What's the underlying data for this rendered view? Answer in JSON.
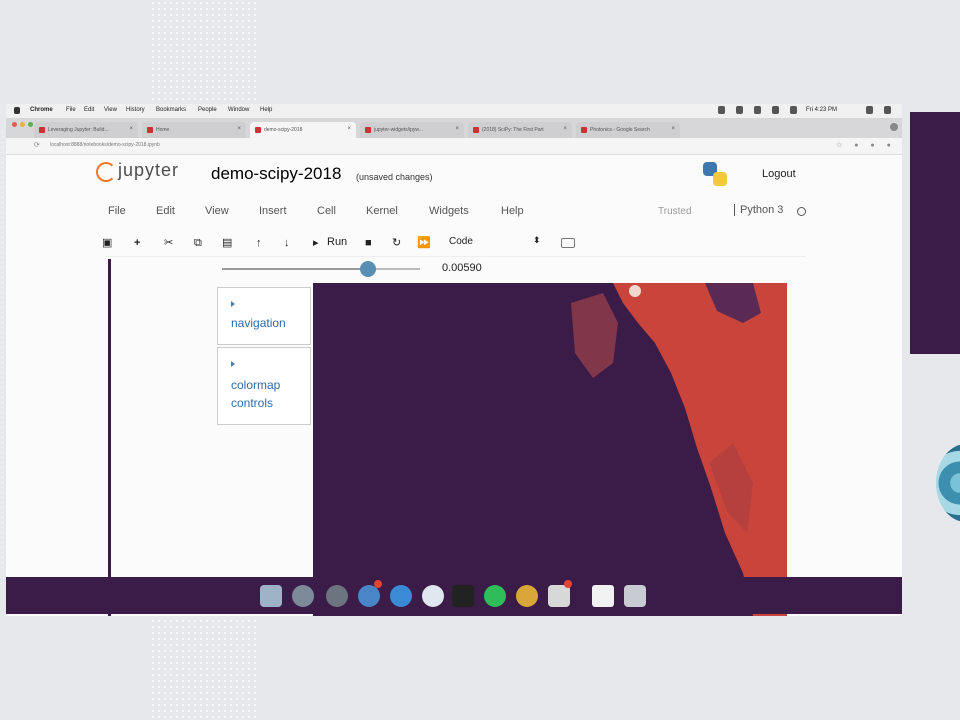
{
  "macos_menubar": {
    "app_name": "Chrome",
    "items": [
      "File",
      "Edit",
      "View",
      "History",
      "Bookmarks",
      "People",
      "Window",
      "Help"
    ],
    "clock": "Fri 4:23 PM"
  },
  "browser": {
    "tabs": [
      {
        "title": "Leveraging Jupyter: Build..."
      },
      {
        "title": "Home"
      },
      {
        "title": "demo-scipy-2018",
        "active": true
      },
      {
        "title": "jupyter-widgets/ipyw..."
      },
      {
        "title": "(2018) SciPy: The First Part"
      },
      {
        "title": "Photonics - Google Search"
      }
    ],
    "url": "localhost:8888/notebooks/demo-scipy-2018.ipynb"
  },
  "header": {
    "logo_text": "jupyter",
    "notebook_name": "demo-scipy-2018",
    "save_status": "(unsaved changes)",
    "logout_label": "Logout"
  },
  "menu": {
    "items": [
      "File",
      "Edit",
      "View",
      "Insert",
      "Cell",
      "Kernel",
      "Widgets",
      "Help"
    ],
    "trusted_label": "Trusted",
    "kernel_name": "Python 3"
  },
  "toolbar": {
    "run_label": "Run",
    "cell_type": "Code"
  },
  "widget": {
    "slider_value": "0.00590",
    "slider_fraction": 0.74,
    "accordions": [
      {
        "label": "navigation"
      },
      {
        "label": "colormap controls"
      }
    ]
  },
  "plot": {
    "colors": {
      "background": "#3b1c48",
      "highlight": "#c9443a"
    }
  },
  "dock": {
    "apps": [
      "Finder",
      "Launchpad",
      "System Preferences",
      "App Store",
      "Safari",
      "Preview",
      "Terminal",
      "Spotify",
      "Chrome",
      "Slack",
      "Script Editor",
      "Trash"
    ]
  }
}
